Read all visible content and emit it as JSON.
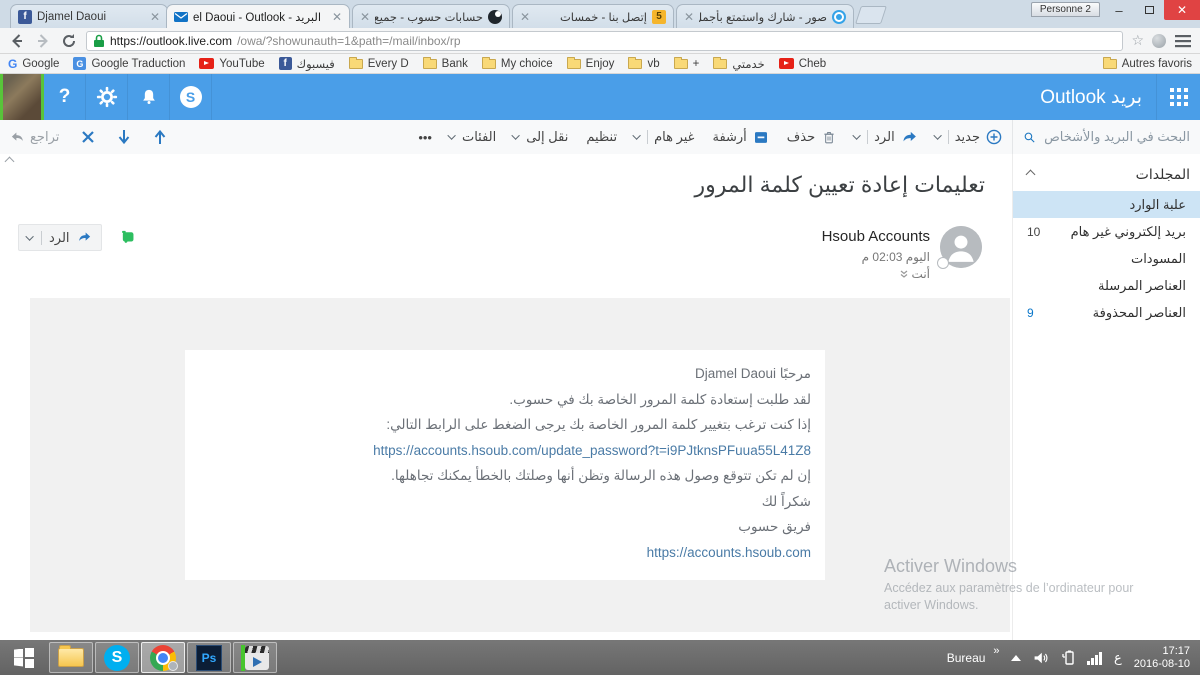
{
  "browser": {
    "tabs": [
      {
        "title": "Djamel Daoui"
      },
      {
        "title": "el Daoui - Outlook - البريد"
      },
      {
        "title": "حسابات حسوب - جميع خد"
      },
      {
        "title": "إتصل بنا - خمسات"
      },
      {
        "title": "صور - شارك واستمتع بأجمل"
      }
    ],
    "profile_label": "Personne 2",
    "url_main": "https://outlook.live.com",
    "url_path": "/owa/?showunauth=1&path=/mail/inbox/rp",
    "bookmarks": [
      {
        "label": "Google"
      },
      {
        "label": "Google Traduction"
      },
      {
        "label": "YouTube"
      },
      {
        "label": "فيسبوك"
      },
      {
        "label": "Every D"
      },
      {
        "label": "Bank"
      },
      {
        "label": "My choice"
      },
      {
        "label": "Enjoy"
      },
      {
        "label": "vb"
      },
      {
        "label": "+"
      },
      {
        "label": "خدمتي"
      },
      {
        "label": "Cheb"
      }
    ],
    "other_favorites": "Autres favoris"
  },
  "outlook": {
    "brand": "بريد Outlook",
    "search_placeholder": "البحث في البريد والأشخاص",
    "toolbar": {
      "new": "جديد",
      "reply": "الرد",
      "delete": "حذف",
      "archive": "أرشفة",
      "junk": "غير هام",
      "sweep": "تنظيم",
      "move": "نقل إلى",
      "categories": "الفئات",
      "more": "•••",
      "undo": "تراجع"
    },
    "folders": {
      "header": "المجلدات",
      "items": [
        {
          "label": "علبة الوارد",
          "count": ""
        },
        {
          "label": "بريد إلكتروني غير هام",
          "count": "10"
        },
        {
          "label": "المسودات",
          "count": ""
        },
        {
          "label": "العناصر المرسلة",
          "count": ""
        },
        {
          "label": "العناصر المحذوفة",
          "count": "9"
        }
      ]
    },
    "message": {
      "subject": "تعليمات إعادة تعيين كلمة المرور",
      "sender": "Hsoub Accounts",
      "time": "اليوم 02:03 م",
      "to_label": "أنت",
      "reply_label": "الرد",
      "body_lines": [
        "مرحبًا Djamel Daoui",
        "لقد طلبت إستعادة كلمة المرور الخاصة بك في حسوب.",
        "إذا كنت ترغب بتغيير كلمة المرور الخاصة بك يرجى الضغط على الرابط التالي:",
        "https://accounts.hsoub.com/update_password?t=i9PJtknsPFuua55L41Z8",
        "إن لم تكن تتوقع وصول هذه الرسالة وتظن أنها وصلتك بالخطأ يمكنك تجاهلها.",
        "شكراً لك",
        "فريق حسوب",
        "https://accounts.hsoub.com"
      ]
    }
  },
  "watermark": {
    "line1": "Activer Windows",
    "line2": "Accédez aux paramètres de l’ordinateur pour activer Windows."
  },
  "taskbar": {
    "desktop_label": "Bureau",
    "language": "ع",
    "time": "17:17",
    "date": "2016-08-10"
  },
  "colors": {
    "outlook_blue": "#4a9ee8",
    "accent_blue": "#2b79c2",
    "link_blue": "#4a7ba6",
    "selected_folder": "#cde4f5"
  }
}
